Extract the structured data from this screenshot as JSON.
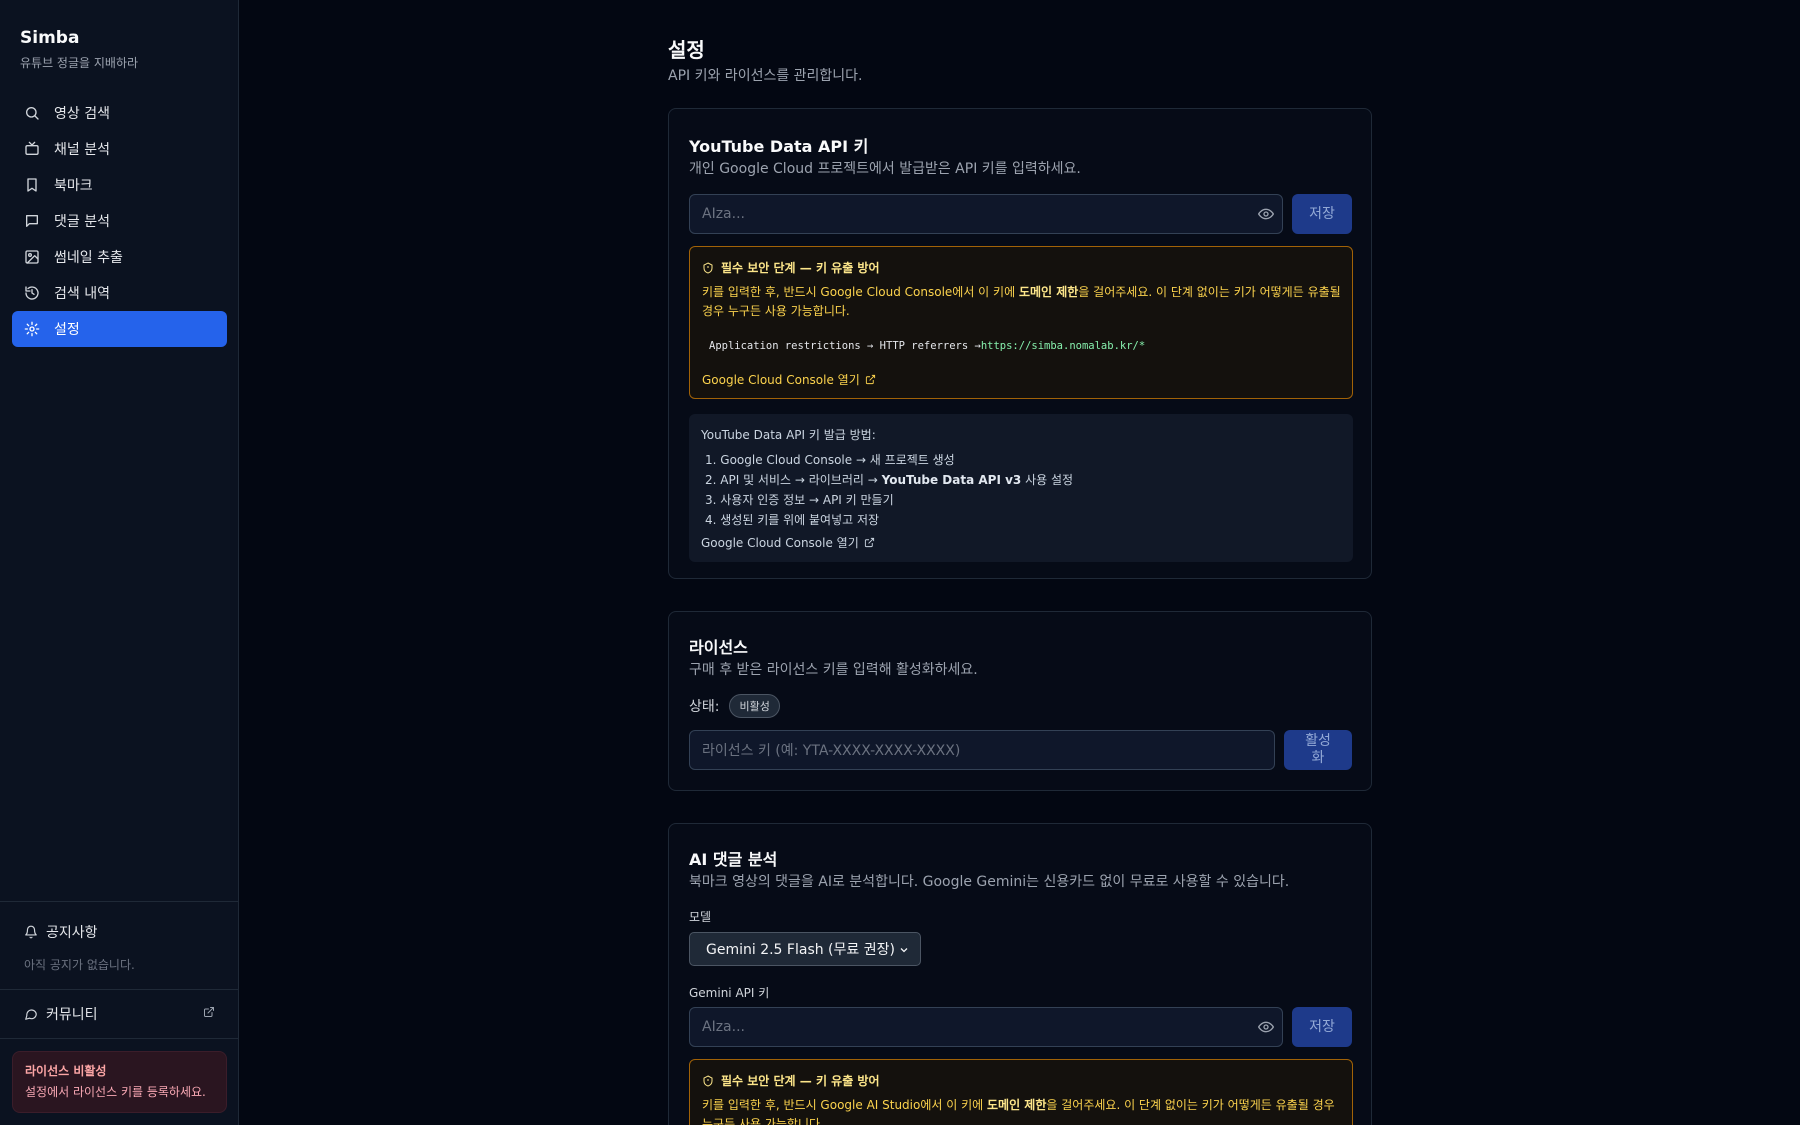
{
  "sidebar": {
    "brand": "Simba",
    "tagline": "유튜브 정글을 지배하라",
    "items": [
      {
        "label": "영상 검색",
        "icon": "search-icon"
      },
      {
        "label": "채널 분석",
        "icon": "tv-icon"
      },
      {
        "label": "북마크",
        "icon": "bookmark-icon"
      },
      {
        "label": "댓글 분석",
        "icon": "message-icon"
      },
      {
        "label": "썸네일 추출",
        "icon": "image-icon"
      },
      {
        "label": "검색 내역",
        "icon": "history-icon"
      },
      {
        "label": "설정",
        "icon": "gear-icon",
        "active": true
      }
    ],
    "notice_title": "공지사항",
    "notice_empty": "아직 공지가 없습니다.",
    "community": "커뮤니티",
    "license_warning_title": "라이선스 비활성",
    "license_warning_text": "설정에서 라이선스 키를 등록하세요."
  },
  "page": {
    "title": "설정",
    "subtitle": "API 키와 라이선스를 관리합니다."
  },
  "youtube": {
    "title": "YouTube Data API 키",
    "description": "개인 Google Cloud 프로젝트에서 발급받은 API 키를 입력하세요.",
    "placeholder": "AIza...",
    "save": "저장",
    "warn_title": "필수 보안 단계 — 키 유출 방어",
    "warn_pre": "키를 입력한 후, 반드시 Google Cloud Console에서 이 키에 ",
    "warn_bold": "도메인 제한",
    "warn_post": "을 걸어주세요. 이 단계 없이는 키가 어떻게든 유출될 경우 누구든 사용 가능합니다.",
    "code_prefix": "Application restrictions → HTTP referrers → ",
    "code_url": "https://simba.nomalab.kr/*",
    "warn_link": "Google Cloud Console 열기",
    "howto_title": "YouTube Data API 키 발급 방법:",
    "step1": "1. Google Cloud Console → 새 프로젝트 생성",
    "step2_pre": "2. API 및 서비스 → 라이브러리 → ",
    "step2_bold": "YouTube Data API v3",
    "step2_post": " 사용 설정",
    "step3": "3. 사용자 인증 정보 → API 키 만들기",
    "step4": "4. 생성된 키를 위에 붙여넣고 저장",
    "howto_link": "Google Cloud Console 열기"
  },
  "license": {
    "title": "라이선스",
    "description": "구매 후 받은 라이선스 키를 입력해 활성화하세요.",
    "status_label": "상태:",
    "status_value": "비활성",
    "placeholder": "라이선스 키 (예: YTA-XXXX-XXXX-XXXX)",
    "activate_line1": "활성",
    "activate_line2": "화"
  },
  "ai": {
    "title": "AI 댓글 분석",
    "description": "북마크 영상의 댓글을 AI로 분석합니다. Google Gemini는 신용카드 없이 무료로 사용할 수 있습니다.",
    "model_label": "모델",
    "model_value": "Gemini 2.5 Flash (무료 권장)",
    "key_label": "Gemini API 키",
    "placeholder": "AIza...",
    "save": "저장",
    "warn_title": "필수 보안 단계 — 키 유출 방어",
    "warn_pre": "키를 입력한 후, 반드시 Google AI Studio에서 이 키에 ",
    "warn_bold": "도메인 제한",
    "warn_post": "을 걸어주세요. 이 단계 없이는 키가 어떻게든 유출될 경우 누구든 사용 가능합니다."
  },
  "colors": {
    "background": "#030712",
    "accent": "#2563eb",
    "warning": "#a16207"
  }
}
